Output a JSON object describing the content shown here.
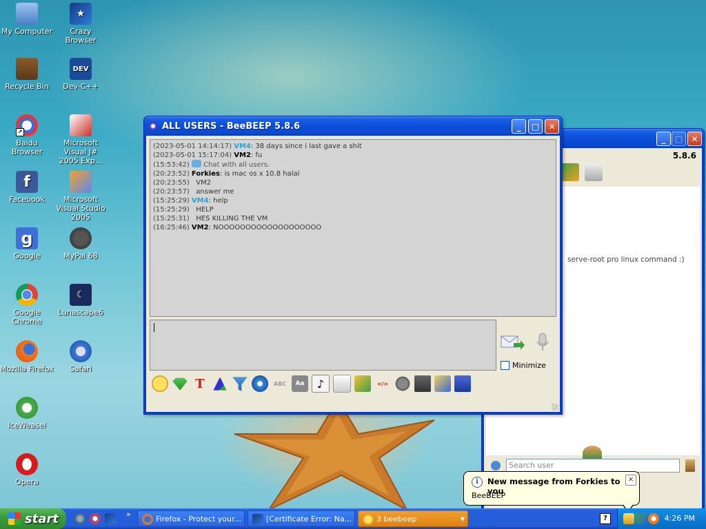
{
  "desktop": {
    "icons": [
      {
        "label": "My Computer"
      },
      {
        "label": "Crazy Browser"
      },
      {
        "label": "Recycle Bin"
      },
      {
        "label": "Dev-C++"
      },
      {
        "label": "Baidu Browser"
      },
      {
        "label": "Microsoft Visual J# 2005 Exp..."
      },
      {
        "label": "Facebook"
      },
      {
        "label": "Microsoft Visual Studio 2005"
      },
      {
        "label": "Google"
      },
      {
        "label": "MyPal 68"
      },
      {
        "label": "Google Chrome"
      },
      {
        "label": "Lunascape6"
      },
      {
        "label": "Mozilla Firefox"
      },
      {
        "label": "Safari"
      },
      {
        "label": "IceWeasel"
      },
      {
        "label": "Opera"
      }
    ],
    "dev_icon_text": "DEV",
    "google_icon_text": "g",
    "facebook_icon_text": "f"
  },
  "chat_window": {
    "title": "ALL USERS - BeeBEEP 5.8.6",
    "messages": [
      {
        "ts": "(2023-05-01 14:14:17)",
        "user": "VM4",
        "text": ": 38 days since i last gave a shit"
      },
      {
        "ts": "(2023-05-01 15:17:04)",
        "user": "VM2",
        "text": ": fu"
      },
      {
        "ts": "(15:53:42)",
        "user": "",
        "text": "Chat with all users."
      },
      {
        "ts": "(20:23:52)",
        "user": "Forkies",
        "text": ": is mac os x 10.8 halal"
      },
      {
        "ts": "(20:23:55)",
        "user": "",
        "text": "VM2"
      },
      {
        "ts": "(20:23:57)",
        "user": "",
        "text": "answer me"
      },
      {
        "ts": "(15:25:29)",
        "user": "VM4",
        "text": ": help"
      },
      {
        "ts": "(15:25:29)",
        "user": "",
        "text": "HELP"
      },
      {
        "ts": "(15:25:31)",
        "user": "",
        "text": "HES KILLING THE VM"
      },
      {
        "ts": "(16:25:46)",
        "user": "VM2",
        "text": ": NOOOOOOOOOOOOOOOOOOO"
      }
    ],
    "minimize_label": "Minimize"
  },
  "main_window": {
    "version": "5.8.6",
    "status_text": "serve-root pro linux command :)",
    "search_placeholder": "Search user"
  },
  "notification": {
    "title": "New message from Forkies to you",
    "body": "BeeBEEP",
    "info_glyph": "i",
    "close_glyph": "×"
  },
  "taskbar": {
    "start_label": "start",
    "chevron": "»",
    "tasks": [
      {
        "label": "Firefox - Protect your..."
      },
      {
        "label": "[Certificate Error: Na..."
      },
      {
        "label": "3  beebeep"
      }
    ],
    "help_glyph": "?",
    "clock": "4:26 PM"
  }
}
